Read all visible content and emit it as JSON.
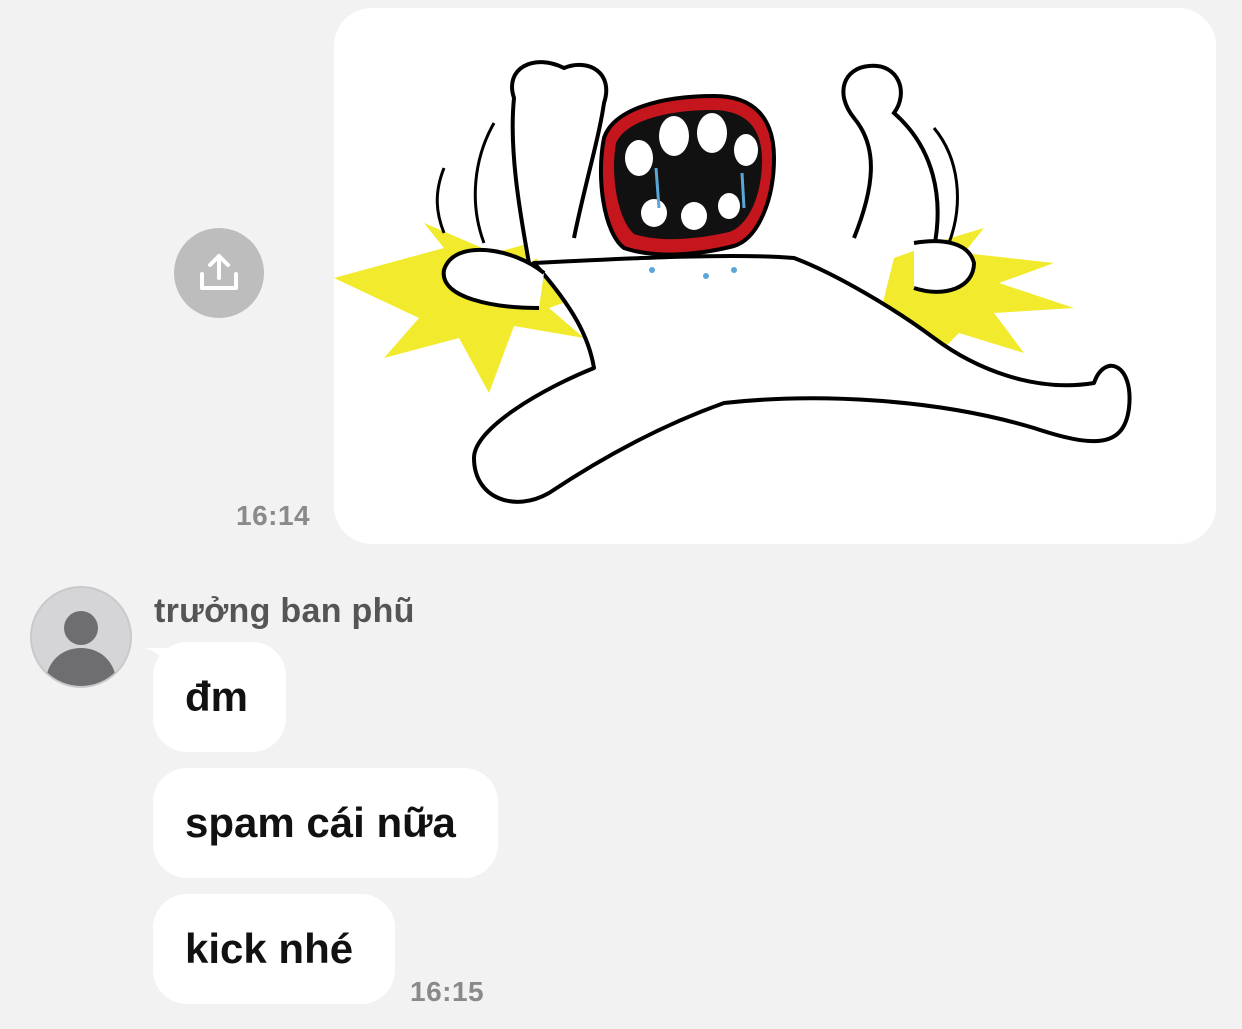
{
  "conversation": {
    "image_message": {
      "image": "crying-tantrum-cartoon-sticker",
      "timestamp": "16:14",
      "share_icon": "share-upload-icon"
    },
    "incoming": {
      "sender_name": "trưởng ban phũ",
      "avatar_icon": "default-user-avatar-icon",
      "messages": [
        {
          "text": "đm"
        },
        {
          "text": "spam cái nữa"
        },
        {
          "text": "kick nhé"
        }
      ],
      "timestamp": "16:15"
    }
  },
  "colors": {
    "background": "#f2f2f2",
    "bubble": "#ffffff",
    "share_button": "#bdbdbd",
    "timestamp": "#8a8a8a",
    "sticker_yellow": "#f2ea2c",
    "sticker_red": "#c4161c"
  }
}
